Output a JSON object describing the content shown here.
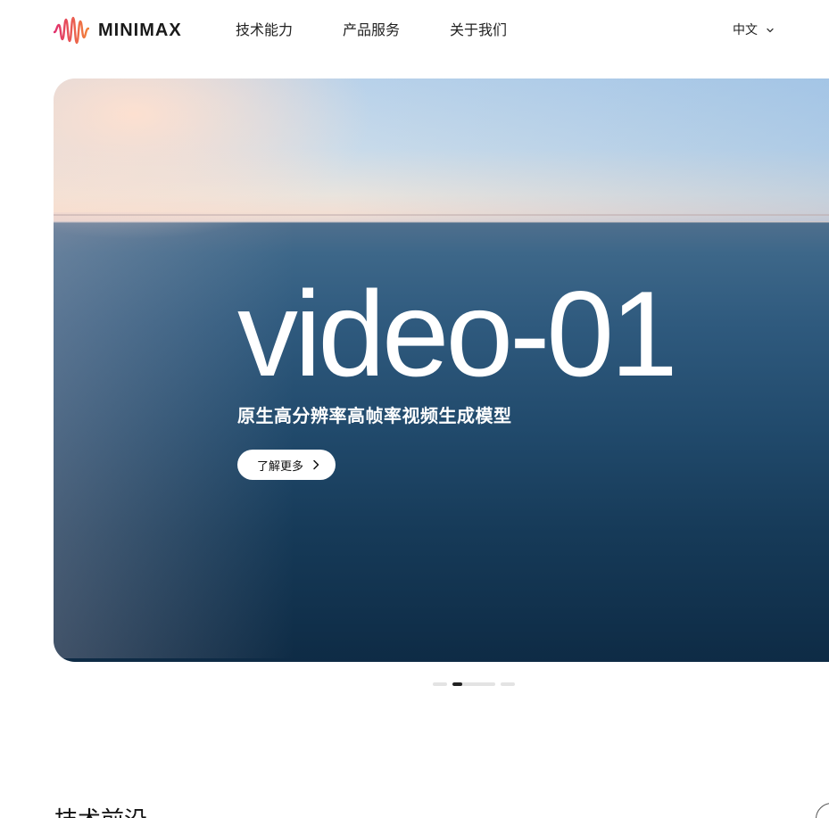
{
  "header": {
    "logo_text": "MINIMAX",
    "nav": [
      "技术能力",
      "产品服务",
      "关于我们"
    ],
    "language": "中文"
  },
  "hero": {
    "title": "video-01",
    "subtitle": "原生高分辨率高帧率视频生成模型",
    "cta_label": "了解更多"
  },
  "carousel": {
    "slide_count": 4,
    "active_index": 1
  },
  "section": {
    "title": "技术前沿"
  },
  "colors": {
    "logo_gradient_start": "#e03a6a",
    "logo_gradient_end": "#f07a3a",
    "text": "#111111",
    "active_dot": "#222222",
    "inactive_dot": "#e3e3e3"
  }
}
